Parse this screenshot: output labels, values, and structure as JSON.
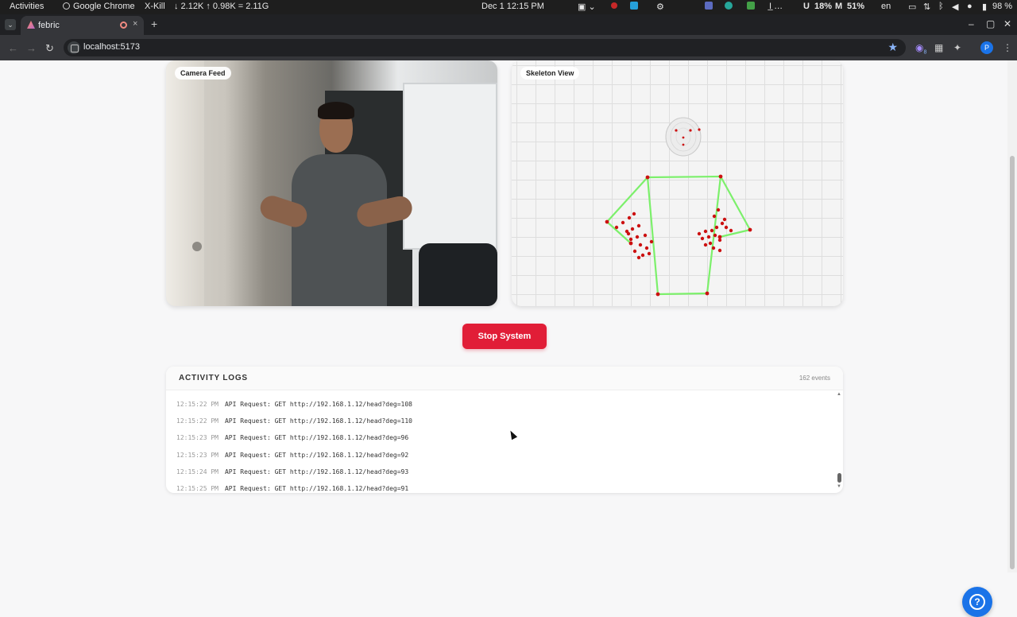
{
  "os_bar": {
    "activities": "Activities",
    "app_name": "Google Chrome",
    "xkill": "X-Kill",
    "net_speed": "↓ 2.12K ↑ 0.98K = 2.11G",
    "datetime": "Dec 1  12:15 PM",
    "cpu": "U",
    "cpu_value": "18%",
    "mem": "M",
    "mem_value": "51%",
    "lang": "en",
    "battery": "98 %"
  },
  "browser": {
    "tab_title": "febric",
    "url": "localhost:5173",
    "new_tab": "+",
    "tab_close": "×",
    "profile_initial": "P",
    "extension_badge": "8"
  },
  "panels": {
    "camera_label": "Camera Feed",
    "skeleton_label": "Skeleton View"
  },
  "controls": {
    "stop_label": "Stop System"
  },
  "logs": {
    "title": "ACTIVITY LOGS",
    "count": "162 events",
    "entries": [
      {
        "time": "12:15:22 PM",
        "message": "API Request: GET http://192.168.1.12/head?deg=108"
      },
      {
        "time": "12:15:22 PM",
        "message": "API Request: GET http://192.168.1.12/head?deg=110"
      },
      {
        "time": "12:15:23 PM",
        "message": "API Request: GET http://192.168.1.12/head?deg=96"
      },
      {
        "time": "12:15:23 PM",
        "message": "API Request: GET http://192.168.1.12/head?deg=92"
      },
      {
        "time": "12:15:24 PM",
        "message": "API Request: GET http://192.168.1.12/head?deg=93"
      },
      {
        "time": "12:15:25 PM",
        "message": "API Request: GET http://192.168.1.12/head?deg=91"
      }
    ]
  },
  "colors": {
    "stop_button": "#e11d37",
    "skeleton_line": "#7cf06b",
    "skeleton_joint": "#cc1111",
    "help_button": "#1a73e8"
  }
}
